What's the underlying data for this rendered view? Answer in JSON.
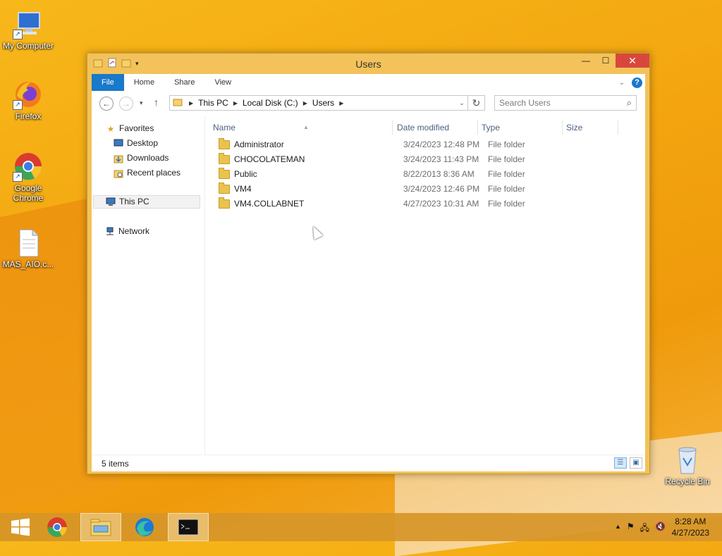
{
  "desktop": {
    "icons": [
      {
        "label": "My Computer"
      },
      {
        "label": "Firefox"
      },
      {
        "label": "Google Chrome"
      },
      {
        "label": "MAS_AIO.c..."
      },
      {
        "label": "Recycle Bin"
      }
    ]
  },
  "window": {
    "title": "Users",
    "close_glyph": "✕",
    "maximize_glyph": "☐",
    "minimize_glyph": "—"
  },
  "ribbon": {
    "tabs": [
      {
        "label": "File"
      },
      {
        "label": "Home"
      },
      {
        "label": "Share"
      },
      {
        "label": "View"
      }
    ]
  },
  "address": {
    "breadcrumbs": [
      {
        "label": "This PC"
      },
      {
        "label": "Local Disk (C:)"
      },
      {
        "label": "Users"
      }
    ]
  },
  "search": {
    "placeholder": "Search Users"
  },
  "navpane": {
    "favorites": "Favorites",
    "items": [
      {
        "label": "Desktop"
      },
      {
        "label": "Downloads"
      },
      {
        "label": "Recent places"
      }
    ],
    "this_pc": "This PC",
    "network": "Network"
  },
  "columns": {
    "name": "Name",
    "date": "Date modified",
    "type": "Type",
    "size": "Size"
  },
  "files": [
    {
      "name": "Administrator",
      "date": "3/24/2023 12:48 PM",
      "type": "File folder"
    },
    {
      "name": "CHOCOLATEMAN",
      "date": "3/24/2023 11:43 PM",
      "type": "File folder"
    },
    {
      "name": "Public",
      "date": "8/22/2013 8:36 AM",
      "type": "File folder"
    },
    {
      "name": "VM4",
      "date": "3/24/2023 12:46 PM",
      "type": "File folder"
    },
    {
      "name": "VM4.COLLABNET",
      "date": "4/27/2023 10:31 AM",
      "type": "File folder"
    }
  ],
  "status": {
    "count": "5 items"
  },
  "taskbar": {
    "time": "8:28 AM",
    "date": "4/27/2023"
  }
}
